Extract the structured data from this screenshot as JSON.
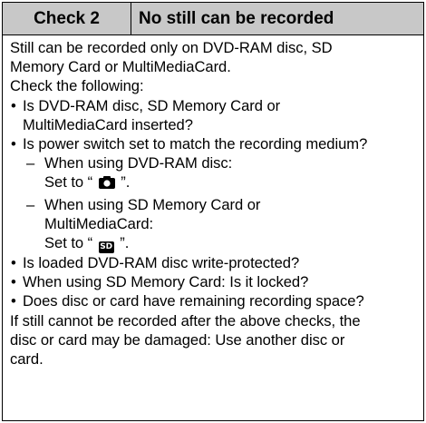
{
  "header": {
    "check_label": "Check 2",
    "title": "No still can be recorded"
  },
  "body": {
    "intro_line1": "Still can be recorded only on DVD-RAM disc, SD",
    "intro_line2": "Memory Card or MultiMediaCard.",
    "check_following": "Check the following:",
    "bullet_char": "•",
    "dash_char": "–",
    "b1_line1": "Is DVD-RAM disc, SD Memory Card or",
    "b1_line2": "MultiMediaCard inserted?",
    "b2_line1": "Is power switch set to match the recording medium?",
    "sub1_line1": "When using DVD-RAM disc:",
    "sub1_line2_prefix": "Set to “ ",
    "sub1_line2_suffix": " ”.",
    "sub2_line1": "When using SD Memory Card or",
    "sub2_line2": "MultiMediaCard:",
    "sub2_line3_prefix": "Set to “ ",
    "sub2_line3_suffix": " ”.",
    "sd_icon_text": "SD",
    "b3": "Is loaded DVD-RAM disc write-protected?",
    "b4": "When using SD Memory Card: Is it locked?",
    "b5": "Does disc or card have remaining recording space?",
    "outro_line1": "If still cannot be recorded after the above checks, the",
    "outro_line2": "disc or card may be damaged: Use another disc or",
    "outro_line3": "card."
  },
  "icons": {
    "camera": "camera-icon",
    "sd": "sd-card-icon"
  },
  "colors": {
    "header_bg": "#c8c8c8",
    "border": "#000000",
    "text": "#000000"
  }
}
